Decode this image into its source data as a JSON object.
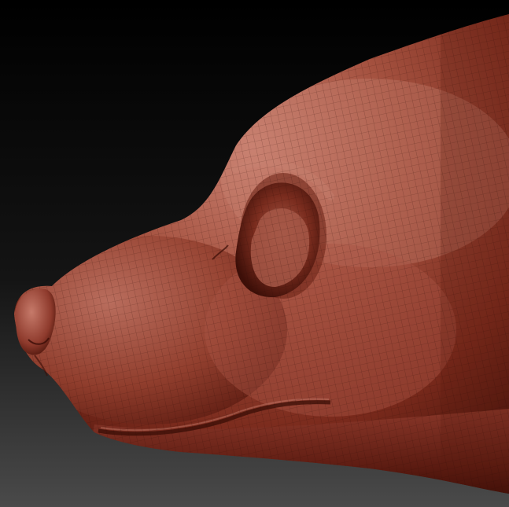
{
  "scene": {
    "subject": "sculpt-head",
    "material": "red-wax",
    "wireframe": true,
    "colors": {
      "background_top": "#000000",
      "background_bottom": "#4a4a4a",
      "clay_base": "#8e3a2c",
      "clay_light": "#c77a6a",
      "clay_shadow": "#3a0d06",
      "clay_rim": "#b05a48",
      "wire": "#2a0a05"
    }
  }
}
